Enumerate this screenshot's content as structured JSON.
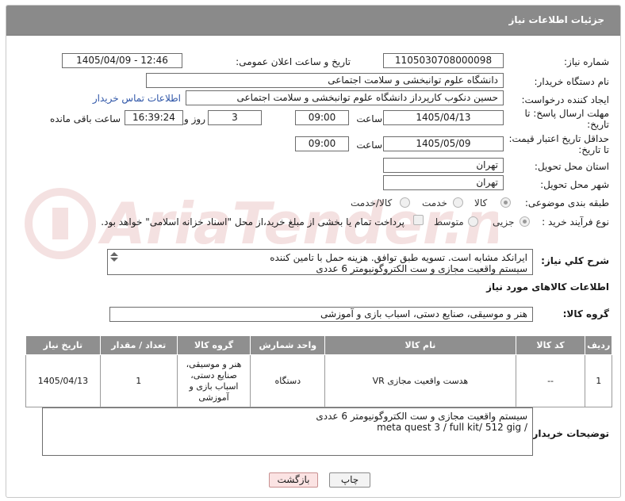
{
  "panel": {
    "title": "جزئیات اطلاعات نیاز"
  },
  "fields": {
    "need_number_label": "شماره نیاز:",
    "need_number": "1105030708000098",
    "announce_label": "تاریخ و ساعت اعلان عمومی:",
    "announce_value": "1405/04/09 - 12:46",
    "buyer_org_label": "نام دستگاه خریدار:",
    "buyer_org": "دانشگاه علوم توانبخشی و سلامت اجتماعی",
    "creator_label": "ایجاد کننده درخواست:",
    "creator": "حسین دنکوب کارپرداز دانشگاه علوم توانبخشی و سلامت اجتماعی",
    "contact_link": "اطلاعات تماس خریدار",
    "deadline_label_1": "مهلت ارسال پاسخ: تا",
    "deadline_label_2": "تاریخ:",
    "deadline_date": "1405/04/13",
    "time_label": "ساعت",
    "deadline_time": "09:00",
    "days_count": "3",
    "days_label": "روز و",
    "remaining_time": "16:39:24",
    "remaining_label": "ساعت باقی مانده",
    "price_valid_label_1": "حداقل تاریخ اعتبار قیمت:",
    "price_valid_label_2": "تا تاریخ:",
    "price_valid_date": "1405/05/09",
    "price_valid_time": "09:00",
    "province_label": "استان محل تحویل:",
    "province": "تهران",
    "city_label": "شهر محل تحویل:",
    "city": "تهران",
    "category_label": "طبقه بندی موضوعی:",
    "category_options": [
      "کالا",
      "خدمت",
      "کالا/خدمت"
    ],
    "category_selected": "کالا",
    "process_label": "نوع فرآیند خرید :",
    "process_options": [
      "جزیی",
      "متوسط"
    ],
    "process_selected": "جزیی",
    "payment_note": "پرداخت تمام یا بخشی از مبلغ خرید،از محل \"اسناد خزانه اسلامی\" خواهد بود."
  },
  "description": {
    "label": "شرح کلي نياز:",
    "line1": "ایرانکد مشابه است. تسویه طبق توافق. هزینه حمل با تامین کننده",
    "line2": "سیستم واقعیت مجازی و ست الکتروگونیومتر 6 عددی"
  },
  "goods_info_title": "اطلاعات کالاهای مورد نیاز",
  "goods_group": {
    "label": "گروه کالا:",
    "value": "هنر و موسیقی، صنایع دستی، اسباب بازی و آموزشی"
  },
  "table": {
    "headers": [
      "ردیف",
      "کد کالا",
      "نام کالا",
      "واحد شمارش",
      "گروه کالا",
      "تعداد / مقدار",
      "تاریخ نیاز"
    ],
    "rows": [
      {
        "row": "1",
        "code": "--",
        "name": "هدست واقعیت مجازی VR",
        "unit": "دستگاه",
        "group": "هنر و موسیقی، صنایع دستی، اسباب بازی و آموزشی",
        "qty": "1",
        "date": "1405/04/13"
      }
    ]
  },
  "buyer_notes": {
    "label": "توضیحات خریدار:",
    "line1": "سیستم واقعیت مجازی و ست الکتروگونیومتر 6 عددی",
    "line2": "meta quest 3 / full kit/ 512 gig /"
  },
  "buttons": {
    "print": "چاپ",
    "back": "بازگشت"
  },
  "watermark": "AriaTender.net"
}
